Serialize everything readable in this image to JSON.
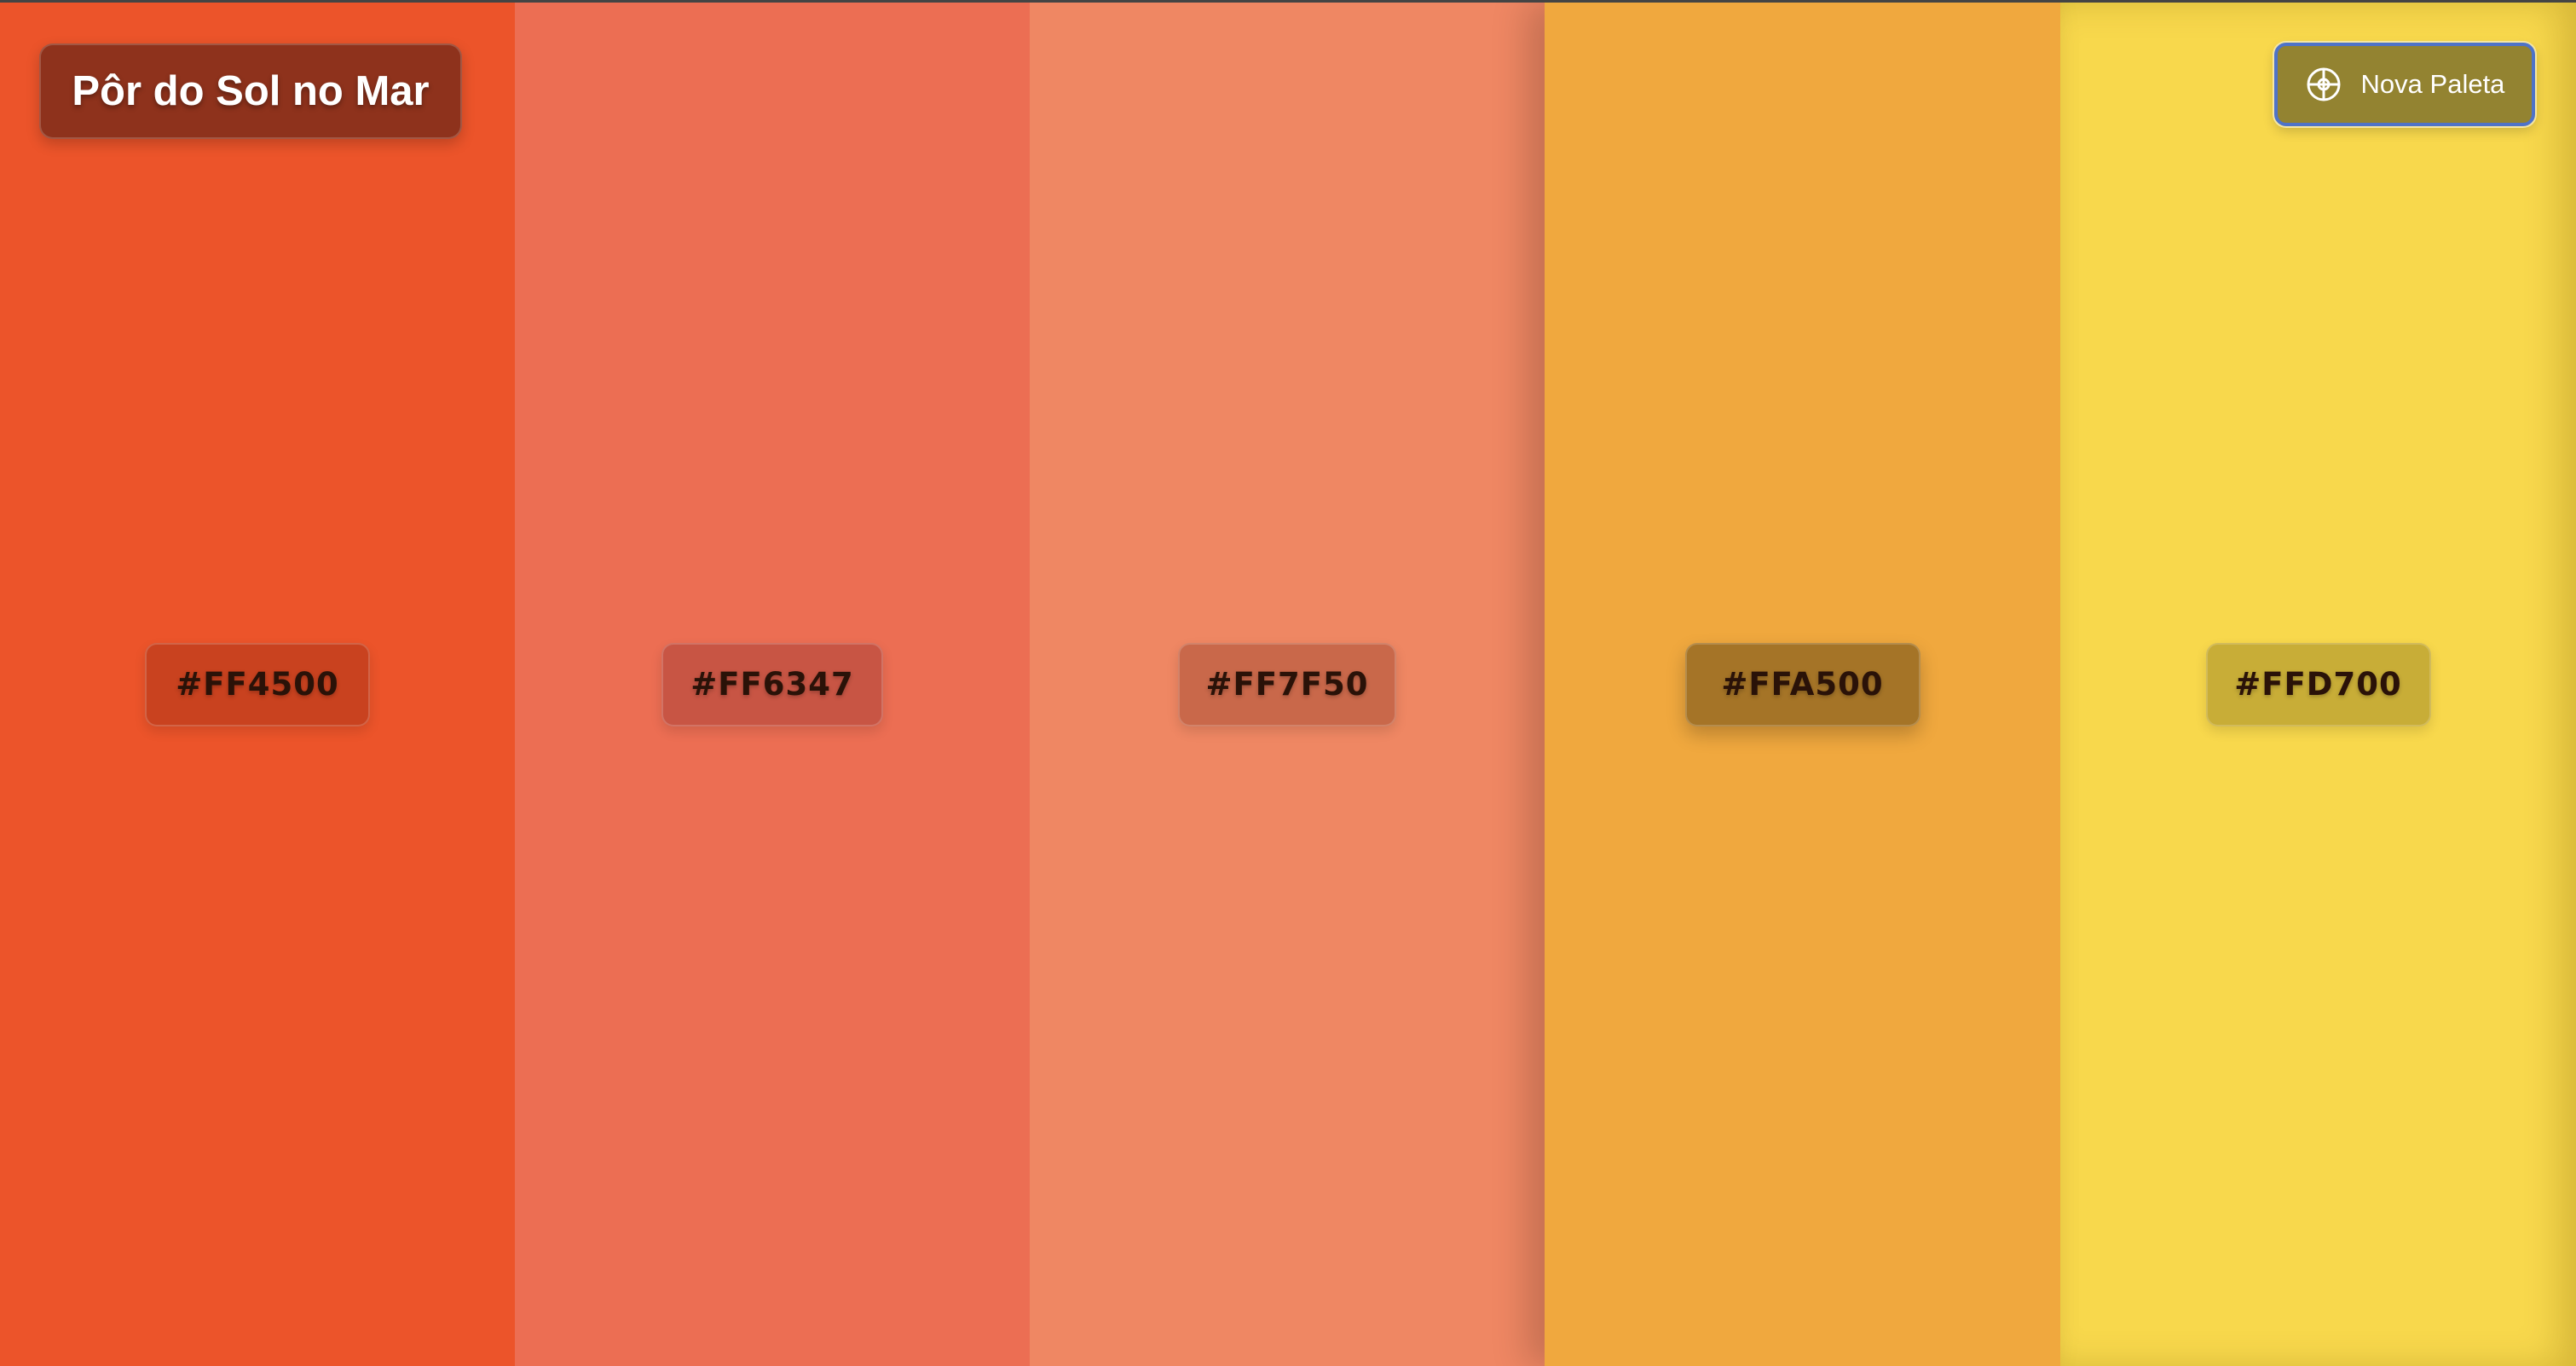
{
  "header": {
    "title": "Pôr do Sol no Mar",
    "new_palette_label": "Nova Paleta",
    "new_palette_icon": "shuffle-wheel-icon"
  },
  "palette": {
    "swatches": [
      {
        "hex": "#FF4500",
        "color": "#EC542A"
      },
      {
        "hex": "#FF6347",
        "color": "#EC6E53"
      },
      {
        "hex": "#FF7F50",
        "color": "#EF8763"
      },
      {
        "hex": "#FFA500",
        "color": "#F0A83E"
      },
      {
        "hex": "#FFD700",
        "color": "#F8D84C"
      }
    ]
  },
  "colors": {
    "title_badge": "#8E321C",
    "button_bg": "#938331",
    "button_border": "#4E73C8"
  }
}
